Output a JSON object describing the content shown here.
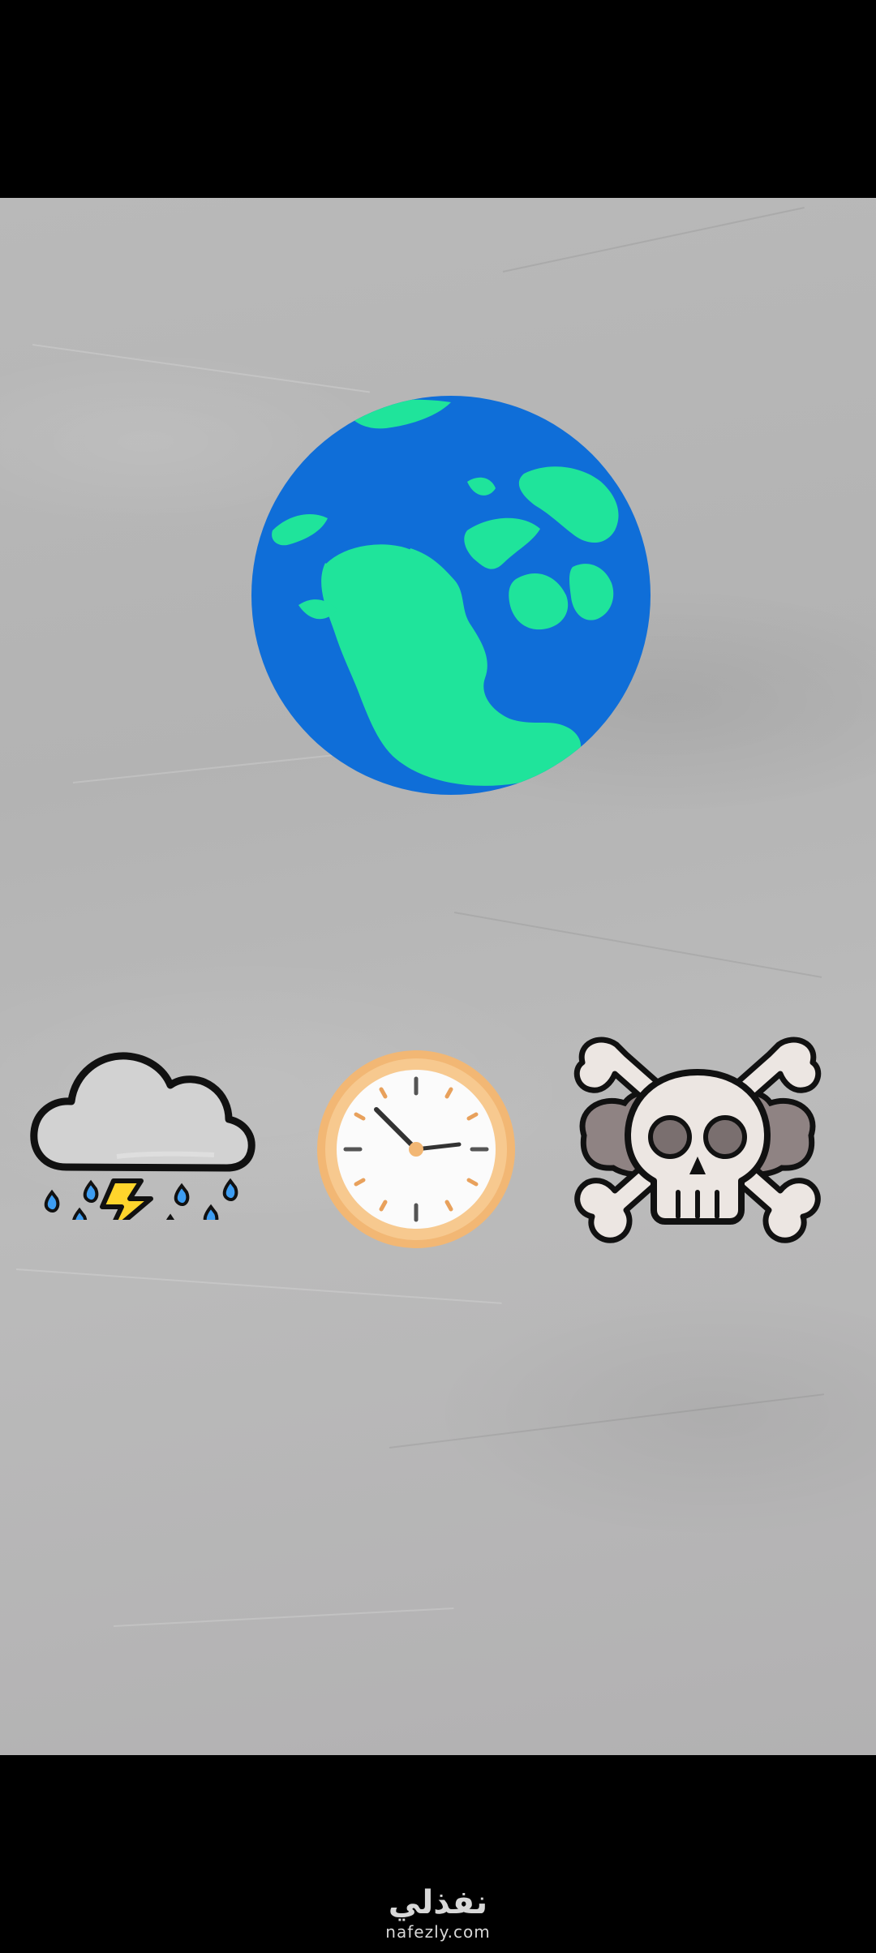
{
  "watermark": {
    "arabic": "نفذلي",
    "latin": "nafezly.com"
  },
  "colors": {
    "top_bar": "#000000",
    "bottom_bar": "#000000",
    "paper": "#b6b6b6",
    "ocean": "#0f6ed8",
    "land": "#1fe49b",
    "clock_rim": "#f2b774",
    "lightning": "#ffd52c",
    "rain": "#3d9df2"
  },
  "icons": {
    "globe": "globe-icon",
    "storm": "storm-cloud-icon",
    "clock": "clock-icon",
    "danger": "skull-crossbones-icon"
  }
}
